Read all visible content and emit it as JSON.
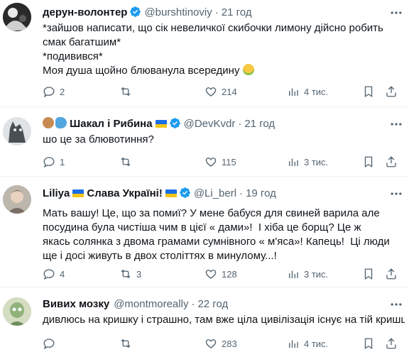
{
  "tweets": [
    {
      "name": "дерун-волонтер",
      "handle": "@burshtinoviy",
      "dot": "·",
      "time": "21 год",
      "text": "*зайшов написати, що сік невеличкої скибочки лимону дійсно робить смак багатшим*\n*подивився*\nМоя душа щойно блюванула всередину",
      "replies": "2",
      "retweets": "",
      "likes": "214",
      "views": "4 тис."
    },
    {
      "name": "Шакал і Рибина",
      "handle": "@DevKvdr",
      "dot": "·",
      "time": "21 год",
      "text": "шо це за блювотиння?",
      "replies": "1",
      "retweets": "",
      "likes": "115",
      "views": "3 тис."
    },
    {
      "name": "Liliya",
      "name2": "Слава Україні!",
      "handle": "@Li_berl",
      "dot": "·",
      "time": "19 год",
      "text": "Мать вашу! Це, що за помиї? У мене бабуся для свиней варила але посудина була чистіша чим в цієї « дами»!  І хіба це борщ? Це ж якась солянка з двома грамами сумнівного « м'яса»! Капець!  Ці люди ще і досі живуть в двох століттях в минулому...! ",
      "replies": "4",
      "retweets": "3",
      "likes": "128",
      "views": "3 тис."
    },
    {
      "name": "Вивих мозку",
      "handle": "@montmoreally",
      "dot": "·",
      "time": "22 год",
      "text": "дивлюсь на кришку і страшно, там вже ціла цивілізація існує на тій кришці",
      "replies": "",
      "retweets": "",
      "likes": "283",
      "views": "4 тис."
    }
  ],
  "colors": {
    "verified": "#1d9bf0",
    "muted": "#536471",
    "text": "#0f1419"
  },
  "icons": [
    "reply-icon",
    "retweet-icon",
    "like-icon",
    "views-icon",
    "bookmark-icon",
    "share-icon",
    "more-icon",
    "verified-icon"
  ]
}
